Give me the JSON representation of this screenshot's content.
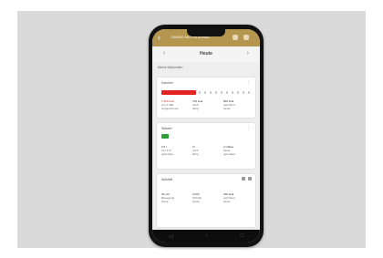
{
  "header": {
    "title": "DIARIO NUTRICIONAL",
    "back_glyph": "‹"
  },
  "day_nav": {
    "label": "Heute",
    "prev_glyph": "‹",
    "next_glyph": "›"
  },
  "section_title": "Meine Mahlzeiten",
  "cards": [
    {
      "title": "Kalorien",
      "bar": "red",
      "columns": [
        {
          "head": "1.500 kcal",
          "lines": [
            "von 2.000",
            "eingenommen"
          ]
        },
        {
          "head": "700 kcal",
          "lines": [
            "noch",
            "übrig"
          ]
        },
        {
          "head": "800 kcal",
          "lines": [
            "verbrannt",
            "heute"
          ]
        }
      ]
    },
    {
      "title": "Wasser",
      "bar": "green",
      "columns": [
        {
          "head": "0,5 l",
          "lines": [
            "von 2,5 l",
            "getrunken"
          ]
        },
        {
          "head": "2 l",
          "lines": [
            "noch",
            "übrig"
          ]
        },
        {
          "head": "2 Gläser",
          "lines": [
            "heute",
            "getrunken"
          ]
        }
      ]
    },
    {
      "title": "Aktivität",
      "columns": [
        {
          "head": "30 min",
          "lines": [
            "Bewegung",
            "heute"
          ]
        },
        {
          "head": "3.200",
          "lines": [
            "Schritte",
            "heute"
          ]
        },
        {
          "head": "200 kcal",
          "lines": [
            "verbrannt",
            "heute"
          ]
        }
      ]
    }
  ],
  "navbar": {
    "back": "◁",
    "home": "○",
    "recent": "□"
  }
}
